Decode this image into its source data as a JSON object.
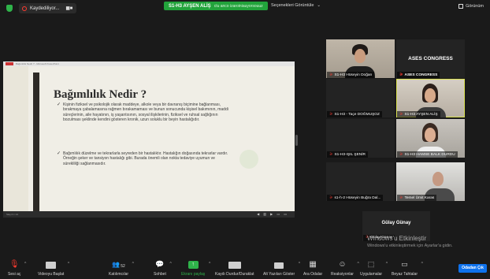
{
  "topbar": {
    "recording_label": "Kaydediliyor...",
    "recording_controls": "▮▮  ■",
    "speaking_name": "S1-H3  AYŞEN ALİŞ",
    "speaking_suffix": "ctu anco izaroiniauyorsouuz",
    "view_options": "Seçenekleri Görüntüle",
    "view_caret": "⌄",
    "fullscreen_label": "Görünüm"
  },
  "share": {
    "window_caption": "Bağımlılık Nedir ? - Microsoft PowerPoint",
    "slide_title": "Bağımlılık Nedir ?",
    "bullet1": "Kişinin fiziksel ve psikolojik olarak maddeye, alkole veya bir davranış biçimine bağlanması, bırakmaya çabalamasına rağmen bırakamaması ve bunun sonucunda kişisel bakımının, maddi süreçlerinin, aile hayatının, iş yaşantısının, sosyal ilişkilerinin, fiziksel ve ruhsal sağlığının bozulması şeklinde kendini gösteren kronik, uzun soluklu bir beyin hastalığıdır.",
    "bullet2": "Bağımlılık düzelme ve tekrarlarla seyreden bir hastalıktır. Hastalığın doğasında tekrarlar vardır. Örneğin şeker ve tansiyon hastalığı gibi. Burada önemli olan nokta tedaviye uyumun ve sürekliliği sağlanmasıdır.",
    "checkmark": "✓",
    "footer_caption": "Slayt 3 / 14",
    "footer_controls": "◀ ▥ ▶ ▭ ▭"
  },
  "tiles": [
    {
      "name": "S1-H3  Hüseyin Doğan"
    },
    {
      "name": "ASES CONGRESS",
      "center": "ASES CONGRESS"
    },
    {
      "name": "S1-H3 - Taçe DOĞMUŞOZ"
    },
    {
      "name": "S1-H3 AYŞEN ALİŞ"
    },
    {
      "name": "S1-H3-IŞIL ŞENİR"
    },
    {
      "name": "S1-H3 HAMSE BALK DURDU"
    },
    {
      "name": "s1-h-2 Hüseyin Buğra Dal..."
    },
    {
      "name": "Temel Ümit Karas"
    }
  ],
  "gulay": {
    "center": "Gülay Günay",
    "name": "Gülay Günay"
  },
  "mic_muted_glyph": "⚞",
  "watermark": {
    "line1": "Windows'u Etkinleştir",
    "line2": "Windows'u etkinleştirmek için Ayarlar'a gidin."
  },
  "toolbar": {
    "audio": "Sesi aç",
    "video": "Videoyu Başlat",
    "participants": "Katılımcılar",
    "participants_count": "52",
    "chat": "Sohbet",
    "share": "Ekranı paylaş",
    "record": "Kaydı Durdur/Duraklat",
    "captions": "Alt Yazıları Göster",
    "breakout": "Ara Odalar",
    "reactions": "Reaksiyonlar",
    "apps": "Uygulamalar",
    "whiteboard": "Beyaz Tahtalar",
    "leave": "Odadan Çık",
    "caret": "^"
  },
  "colors": {
    "share_green": "#2fb34a",
    "leave_blue": "#0e72ed",
    "active_border": "#d9e04f",
    "muted_red": "#ff3b30"
  }
}
